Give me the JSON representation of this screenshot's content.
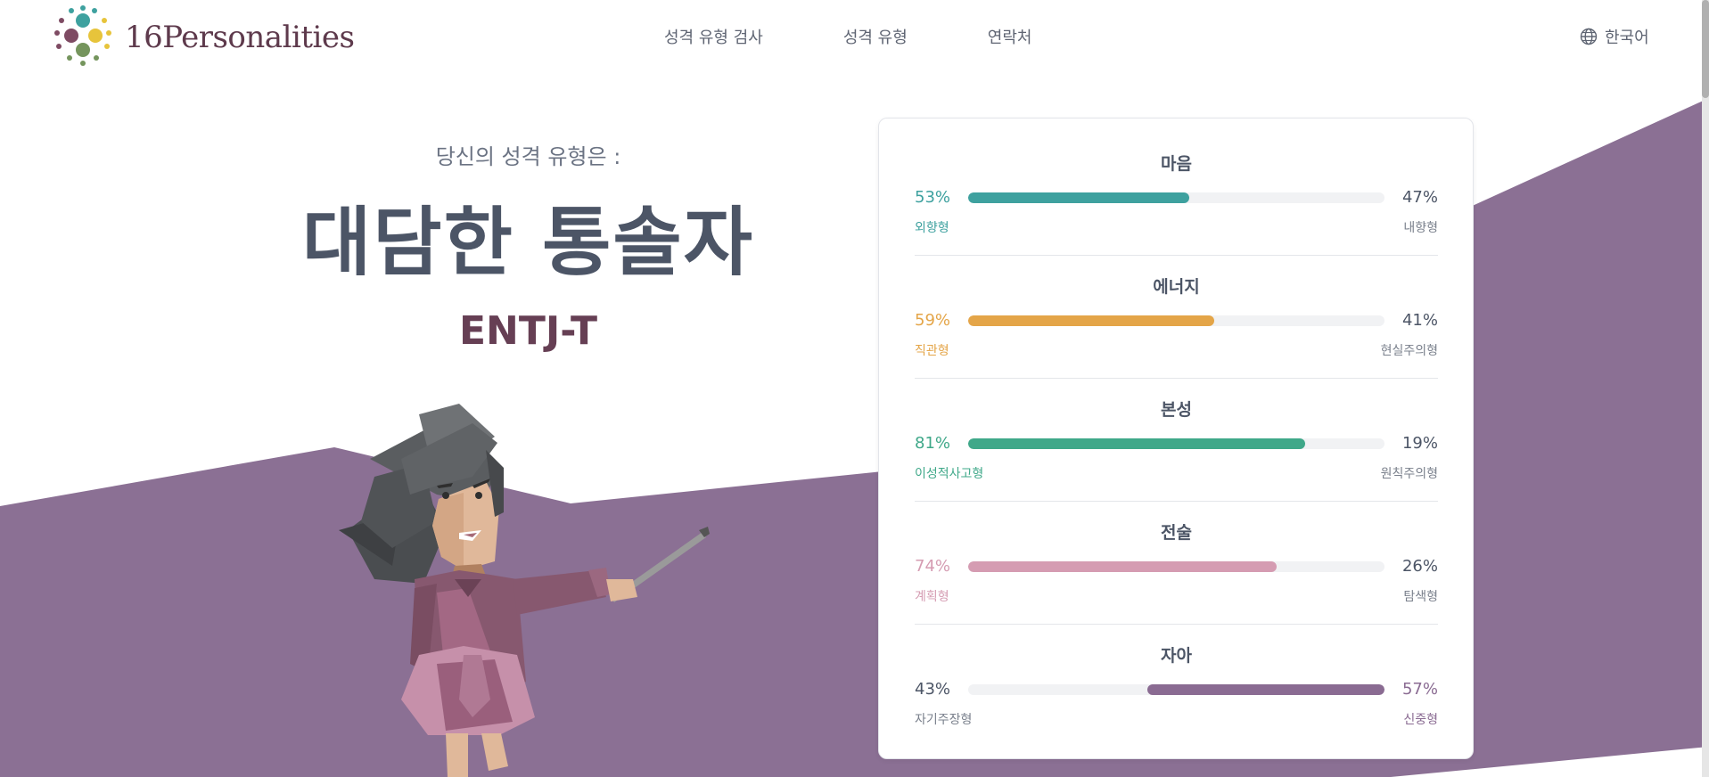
{
  "header": {
    "logo_text": "16Personalities",
    "nav": [
      {
        "label": "성격 유형 검사"
      },
      {
        "label": "성격 유형"
      },
      {
        "label": "연락처"
      }
    ],
    "language": "한국어"
  },
  "hero": {
    "subtitle": "당신의 성격 유형은 :",
    "type_name": "대담한 통솔자",
    "type_code": "ENTJ-T"
  },
  "colors": {
    "background_purple": "#8b7094",
    "mind": "#3ea19f",
    "energy": "#e4a548",
    "nature": "#3fa889",
    "tactics": "#d59cb2",
    "identity": "#8a6b92"
  },
  "traits": [
    {
      "title": "마음",
      "left_pct": "53%",
      "right_pct": "47%",
      "left_label": "외향형",
      "right_label": "내향형",
      "dominant": "left",
      "value": 0.53,
      "color": "#3ea19f"
    },
    {
      "title": "에너지",
      "left_pct": "59%",
      "right_pct": "41%",
      "left_label": "직관형",
      "right_label": "현실주의형",
      "dominant": "left",
      "value": 0.59,
      "color": "#e4a548"
    },
    {
      "title": "본성",
      "left_pct": "81%",
      "right_pct": "19%",
      "left_label": "이성적사고형",
      "right_label": "원칙주의형",
      "dominant": "left",
      "value": 0.81,
      "color": "#3fa889"
    },
    {
      "title": "전술",
      "left_pct": "74%",
      "right_pct": "26%",
      "left_label": "계획형",
      "right_label": "탐색형",
      "dominant": "left",
      "value": 0.74,
      "color": "#d59cb2"
    },
    {
      "title": "자아",
      "left_pct": "43%",
      "right_pct": "57%",
      "left_label": "자기주장형",
      "right_label": "신중형",
      "dominant": "right",
      "value": 0.57,
      "color": "#8a6b92"
    }
  ]
}
